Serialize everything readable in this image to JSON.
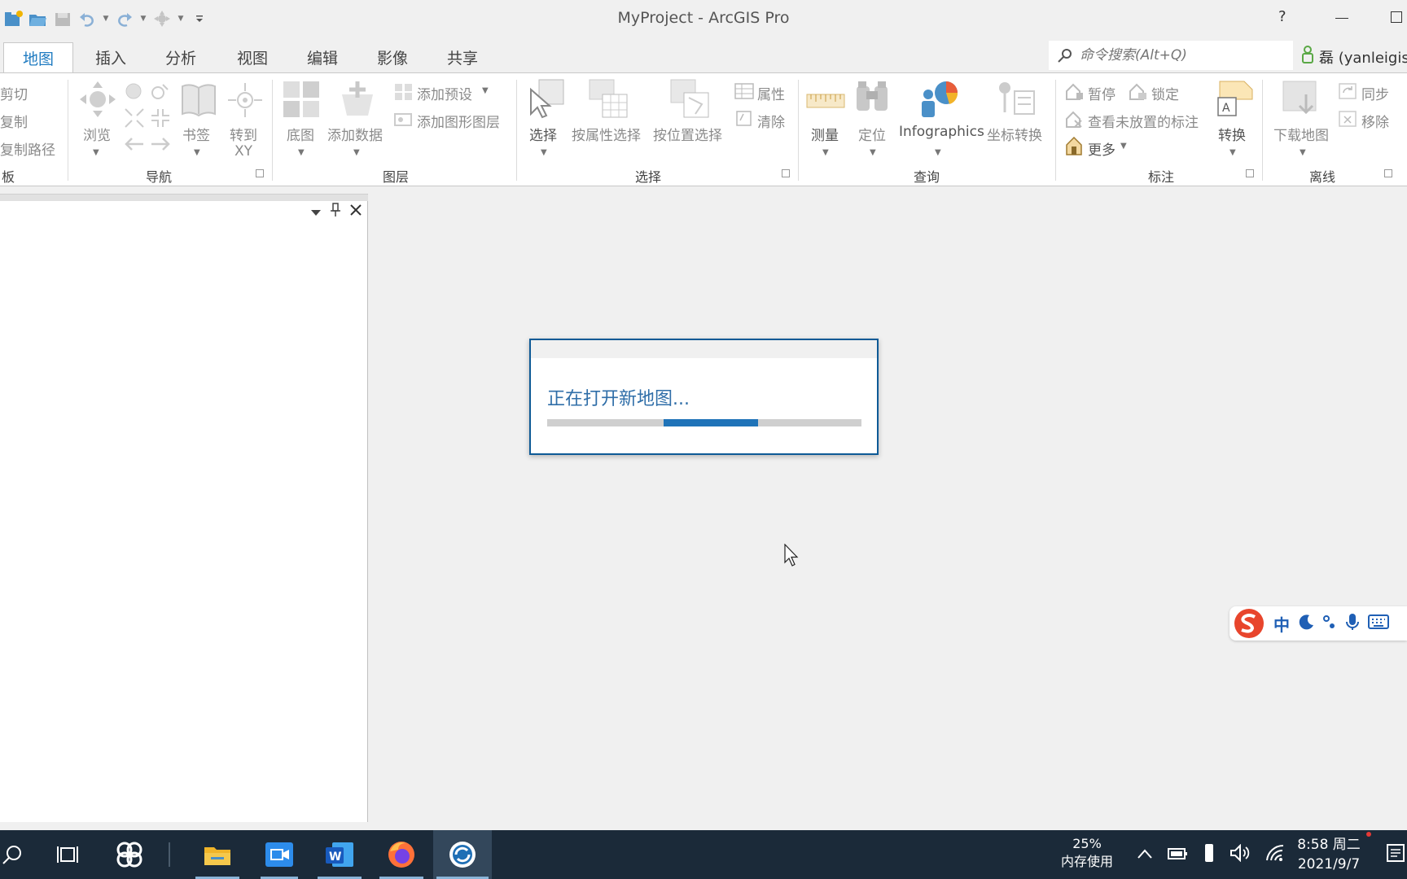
{
  "window": {
    "title": "MyProject - ArcGIS Pro",
    "help": "?"
  },
  "tabs": [
    {
      "label": "地图",
      "active": true
    },
    {
      "label": "插入"
    },
    {
      "label": "分析"
    },
    {
      "label": "视图"
    },
    {
      "label": "编辑"
    },
    {
      "label": "影像"
    },
    {
      "label": "共享"
    }
  ],
  "search": {
    "placeholder": "命令搜索(Alt+Q)"
  },
  "user": {
    "name": "磊 (yanleigis)"
  },
  "ribbon": {
    "clipboard": {
      "cut": "剪切",
      "copy": "复制",
      "copy_path": "复制路径",
      "group": "板"
    },
    "navigation": {
      "explore": "浏览",
      "bookmarks": "书签",
      "goto_xy_1": "转到",
      "goto_xy_2": "XY",
      "group": "导航"
    },
    "layer": {
      "basemap": "底图",
      "add_data": "添加数据",
      "add_preset": "添加预设",
      "add_graphics_layer": "添加图形图层",
      "group": "图层"
    },
    "selection": {
      "select": "选择",
      "select_by_attr": "按属性选择",
      "select_by_loc": "按位置选择",
      "attributes": "属性",
      "clear": "清除",
      "group": "选择"
    },
    "inquiry": {
      "measure": "测量",
      "locate": "定位",
      "infographics": "Infographics",
      "coord_convert": "坐标转换",
      "group": "查询"
    },
    "labeling": {
      "pause": "暂停",
      "lock": "锁定",
      "view_unplaced": "查看未放置的标注",
      "more": "更多",
      "convert": "转换",
      "group": "标注"
    },
    "offline": {
      "download_map": "下载地图",
      "sync": "同步",
      "remove": "移除",
      "group": "离线"
    }
  },
  "dialog": {
    "message": "正在打开新地图...",
    "progress_start": 0.37,
    "progress_end": 0.67
  },
  "ime": {
    "mode": "中"
  },
  "taskbar": {
    "memory_percent": "25%",
    "memory_label": "内存使用",
    "time": "8:58 周二",
    "date": "2021/9/7"
  }
}
